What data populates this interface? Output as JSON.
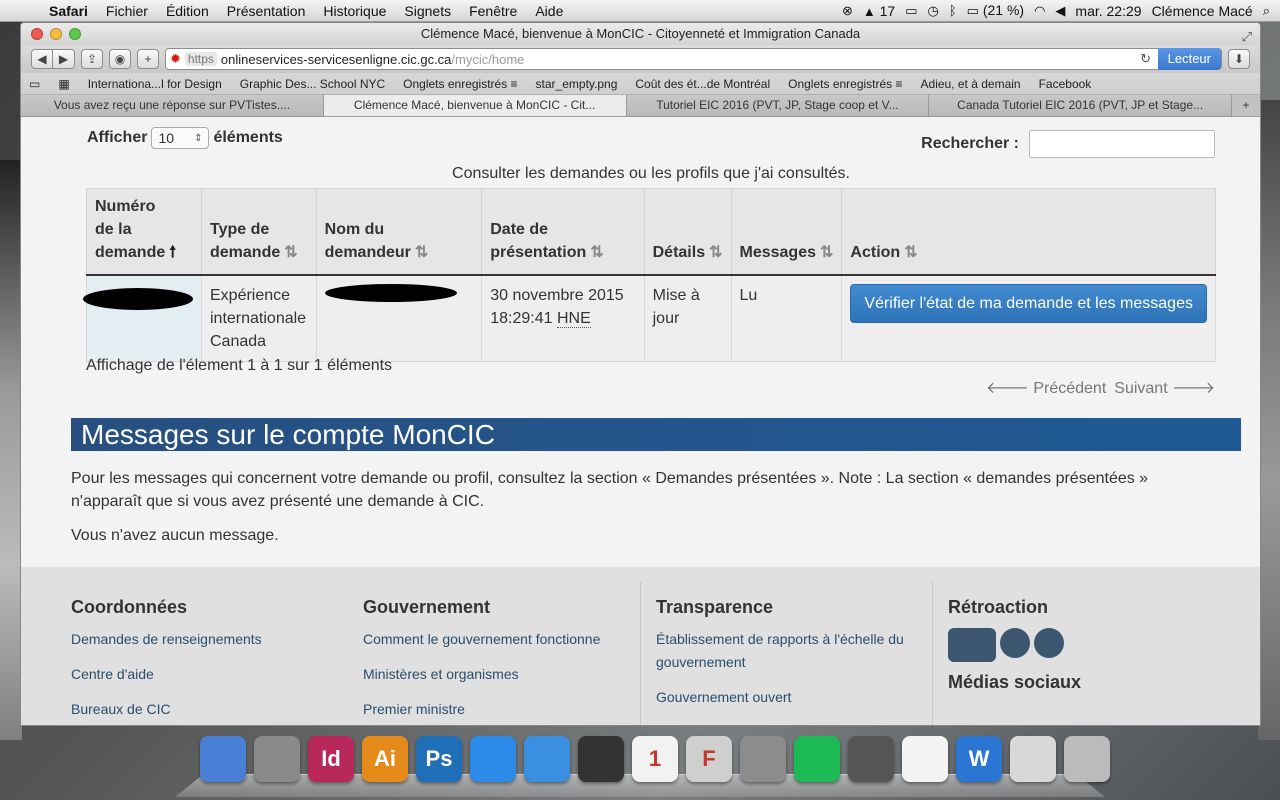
{
  "menubar": {
    "app": "Safari",
    "items": [
      "Fichier",
      "Édition",
      "Présentation",
      "Historique",
      "Signets",
      "Fenêtre",
      "Aide"
    ],
    "status": {
      "adobe": "17",
      "battery": "(21 %)",
      "clock": "mar. 22:29",
      "user": "Clémence Macé"
    }
  },
  "window": {
    "title": "Clémence Macé, bienvenue à MonCIC - Citoyenneté et Immigration Canada",
    "url_https": "https",
    "url_host": "onlineservices-servicesenligne.cic.gc.ca",
    "url_path": "/mycic/home",
    "reader_label": "Lecteur"
  },
  "bookmarks": [
    "Internationa...l for Design",
    "Graphic Des... School NYC",
    "Onglets enregistrés ≡",
    "star_empty.png",
    "Coût des ét...de Montréal",
    "Onglets enregistrés ≡",
    "Adieu, et à demain",
    "Facebook"
  ],
  "tabs": [
    {
      "label": "Vous avez reçu une réponse sur PVTistes...."
    },
    {
      "label": "Clémence Macé, bienvenue à MonCIC - Cit..."
    },
    {
      "label": "Tutoriel EIC 2016 (PVT, JP, Stage coop et V..."
    },
    {
      "label": "Canada Tutoriel EIC 2016 (PVT, JP et Stage..."
    }
  ],
  "table_controls": {
    "show_label": "Afficher",
    "show_value": "10",
    "show_suffix": "éléments",
    "search_label": "Rechercher :",
    "caption": "Consulter les demandes ou les profils que j'ai consultés."
  },
  "table": {
    "headers": {
      "number": [
        "Numéro",
        "de la",
        "demande"
      ],
      "type": [
        "Type de",
        "demande"
      ],
      "name": [
        "Nom du",
        "demandeur"
      ],
      "date": [
        "Date de",
        "présentation"
      ],
      "details": "Détails",
      "messages": "Messages",
      "action": "Action"
    },
    "row": {
      "type": [
        "Expérience",
        "internationale",
        "Canada"
      ],
      "date": "30 novembre 2015",
      "time": "18:29:41",
      "tz": "HNE",
      "details": [
        "Mise à",
        "jour"
      ],
      "messages": "Lu",
      "action": "Vérifier l'état de ma demande et les messages"
    },
    "info": "Affichage de l'élement 1 à 1 sur 1 éléments",
    "prev": "Précédent",
    "next": "Suivant"
  },
  "messages": {
    "title": "Messages sur le compte MonCIC",
    "text": "Pour les messages qui concernent votre demande ou profil, consultez la section « Demandes présentées ». Note : La section « demandes présentées » n'apparaît que si vous avez présenté une demande à CIC.",
    "none": "Vous n'avez aucun message."
  },
  "footer": {
    "col1": {
      "title": "Coordonnées",
      "links": [
        "Demandes de renseignements",
        "Centre d'aide",
        "Bureaux de CIC"
      ]
    },
    "col2": {
      "title": "Gouvernement",
      "links": [
        "Comment le gouvernement fonctionne",
        "Ministères et organismes",
        "Premier ministre"
      ]
    },
    "col3": {
      "title": "Transparence",
      "links": [
        "Établissement de rapports à l'échelle du gouvernement",
        "Gouvernement ouvert"
      ]
    },
    "col4": {
      "title": "Rétroaction",
      "subtitle": "Médias sociaux"
    }
  },
  "dock": {
    "items": [
      {
        "name": "finder",
        "label": "",
        "color": "#4a7fd6"
      },
      {
        "name": "launchpad",
        "label": "",
        "color": "#8a8a8a"
      },
      {
        "name": "indesign",
        "label": "Id",
        "color": "#b8285a"
      },
      {
        "name": "illustrator",
        "label": "Ai",
        "color": "#e48a1a"
      },
      {
        "name": "photoshop",
        "label": "Ps",
        "color": "#1f6fb8"
      },
      {
        "name": "app-store",
        "label": "",
        "color": "#2c8ae8"
      },
      {
        "name": "safari",
        "label": "",
        "color": "#3b8fe0"
      },
      {
        "name": "photo-booth",
        "label": "",
        "color": "#333333"
      },
      {
        "name": "calendar",
        "label": "1",
        "color": "#f2f2f2"
      },
      {
        "name": "font-book",
        "label": "F",
        "color": "#cfcfcf"
      },
      {
        "name": "system-preferences",
        "label": "",
        "color": "#8c8c8c"
      },
      {
        "name": "spotify",
        "label": "",
        "color": "#1db954"
      },
      {
        "name": "photo-slideshow",
        "label": "",
        "color": "#555555"
      },
      {
        "name": "text-edit",
        "label": "",
        "color": "#f3f3f3"
      },
      {
        "name": "word",
        "label": "W",
        "color": "#2a76d2"
      },
      {
        "name": "preview",
        "label": "",
        "color": "#d8d8d8"
      },
      {
        "name": "trash",
        "label": "",
        "color": "#bbbbbb"
      }
    ]
  }
}
